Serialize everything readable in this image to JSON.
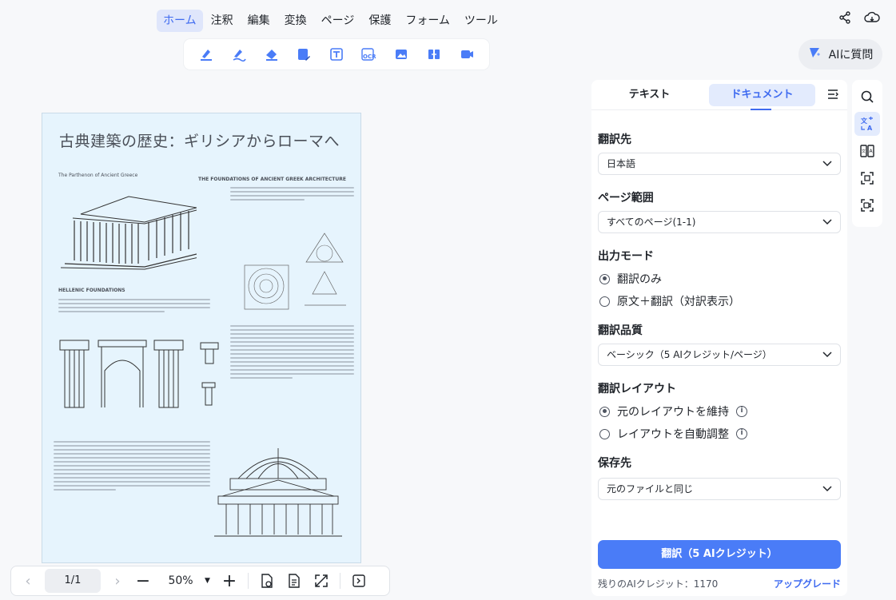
{
  "menu": {
    "items": [
      "ホーム",
      "注釈",
      "編集",
      "変換",
      "ページ",
      "保護",
      "フォーム",
      "ツール"
    ],
    "active": "ホーム"
  },
  "ai_button": {
    "label": "AIに質問"
  },
  "document": {
    "title": "古典建築の歴史：ギリシアからローマへ",
    "caption_left": "The Parthenon of Ancient Greece",
    "caption_right": "THE FOUNDATIONS OF ANCIENT GREEK ARCHITECTURE",
    "caption_mid": "HELLENIC FOUNDATIONS"
  },
  "bottombar": {
    "page": "1/1",
    "zoom": "50%"
  },
  "panel": {
    "tabs": [
      "テキスト",
      "ドキュメント"
    ],
    "active_tab": "ドキュメント",
    "target_label": "翻訳先",
    "target_value": "日本語",
    "range_label": "ページ範囲",
    "range_value": "すべてのページ(1-1)",
    "mode_label": "出力モード",
    "mode_options": [
      "翻訳のみ",
      "原文＋翻訳（対訳表示）"
    ],
    "quality_label": "翻訳品質",
    "quality_value": "ベーシック（5 AIクレジット/ページ）",
    "layout_label": "翻訳レイアウト",
    "layout_options": [
      "元のレイアウトを維持",
      "レイアウトを自動調整"
    ],
    "save_label": "保存先",
    "save_value": "元のファイルと同じ",
    "translate_button": "翻訳（5 AIクレジット）",
    "credits": "残りのAIクレジット：1170",
    "upgrade": "アップグレード"
  },
  "colors": {
    "accent": "#3f6bf0",
    "button": "#4a7cf7",
    "page_bg": "#e6f4fd"
  },
  "icons": {
    "share": "share-icon",
    "cloud": "cloud-icon",
    "search": "search-icon",
    "translate": "translate-icon"
  }
}
